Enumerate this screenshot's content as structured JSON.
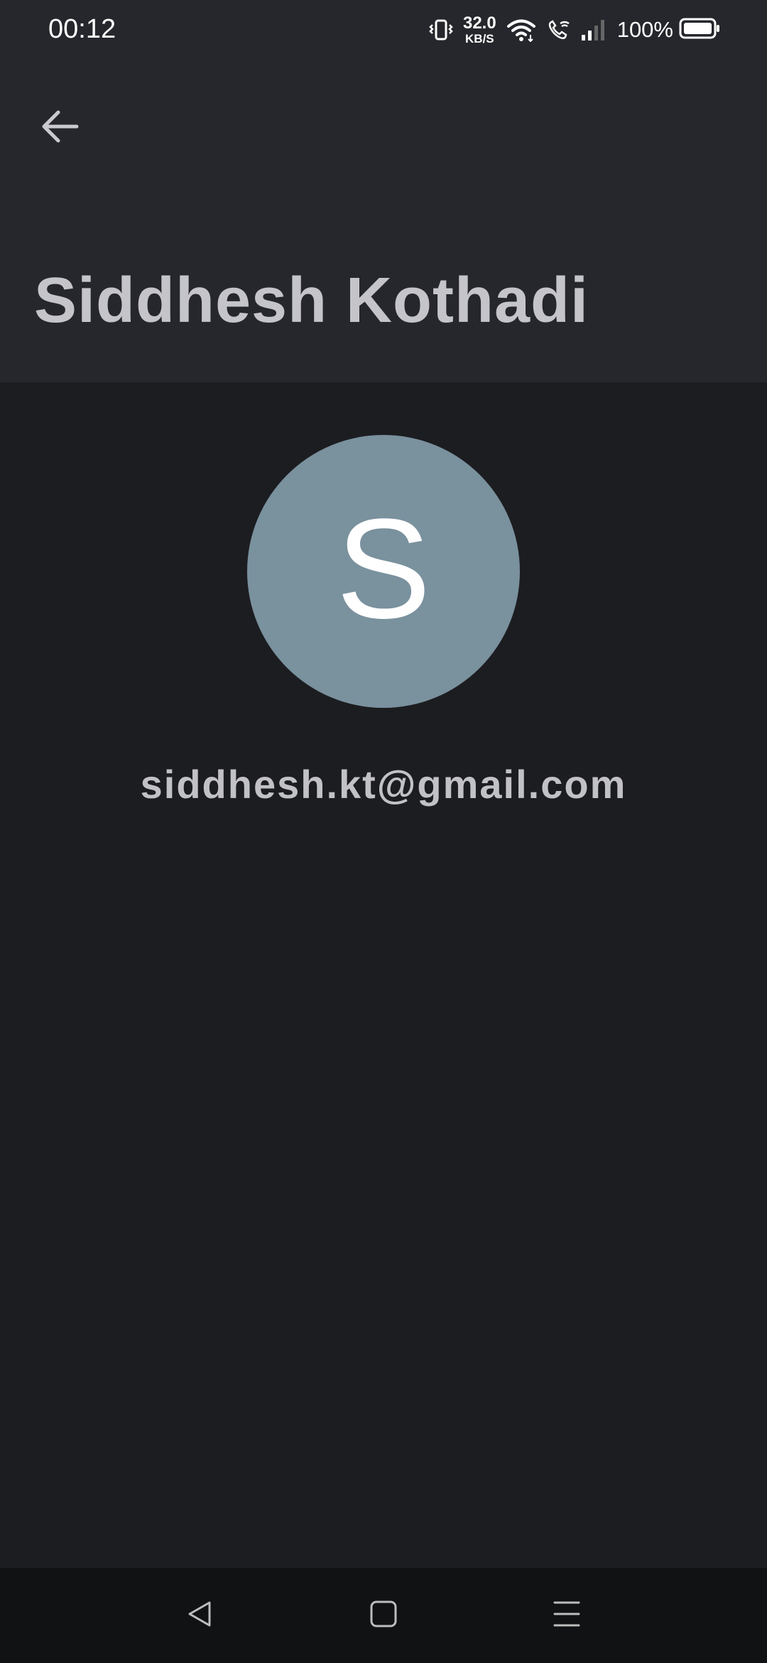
{
  "status_bar": {
    "time": "00:12",
    "net_speed_value": "32.0",
    "net_speed_unit": "KB/S",
    "battery_percent": "100%",
    "icons": [
      "vibrate-icon",
      "wifi-icon",
      "wifi-calling-icon",
      "signal-icon",
      "battery-icon"
    ]
  },
  "header": {
    "back_icon": "arrow-left-icon",
    "title": "Siddhesh Kothadi"
  },
  "profile": {
    "avatar_letter": "S",
    "avatar_color": "#7a919e",
    "email": "siddhesh.kt@gmail.com"
  },
  "nav_bar": {
    "icons": [
      "back-triangle-icon",
      "home-square-icon",
      "recents-menu-icon"
    ]
  },
  "colors": {
    "header_bg": "#26272c",
    "body_bg": "#1c1d20",
    "nav_bg": "#101213",
    "title_text": "#c4c4c9",
    "email_text": "#c1c1c6"
  }
}
